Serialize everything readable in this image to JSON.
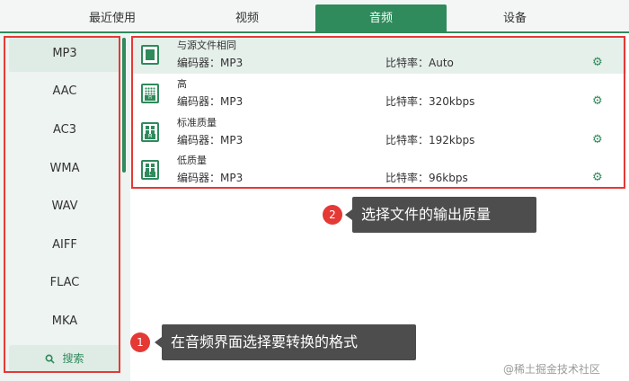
{
  "tabs": [
    {
      "label": "最近使用"
    },
    {
      "label": "视频"
    },
    {
      "label": "音频"
    },
    {
      "label": "设备"
    }
  ],
  "active_tab": "音频",
  "formats": [
    "MP3",
    "AAC",
    "AC3",
    "WMA",
    "WAV",
    "AIFF",
    "FLAC",
    "MKA"
  ],
  "selected_format": "MP3",
  "search": {
    "label": "搜索",
    "icon": "search-icon"
  },
  "quality_rows": [
    {
      "name": "与源文件相同",
      "encoder": "编码器：MP3",
      "bitrate": "比特率：Auto"
    },
    {
      "name": "高",
      "encoder": "编码器：MP3",
      "bitrate": "比特率：320kbps"
    },
    {
      "name": "标准质量",
      "encoder": "编码器：MP3",
      "bitrate": "比特率：192kbps"
    },
    {
      "name": "低质量",
      "encoder": "编码器：MP3",
      "bitrate": "比特率：96kbps"
    }
  ],
  "annotations": {
    "step1_num": "1",
    "step1_text": "在音频界面选择要转换的格式",
    "step2_num": "2",
    "step2_text": "选择文件的输出质量"
  },
  "watermark": "@稀土掘金技术社区",
  "colors": {
    "accent": "#2f8a5c",
    "annotation_red": "#e53935",
    "tooltip_bg": "#4d4d4d"
  }
}
